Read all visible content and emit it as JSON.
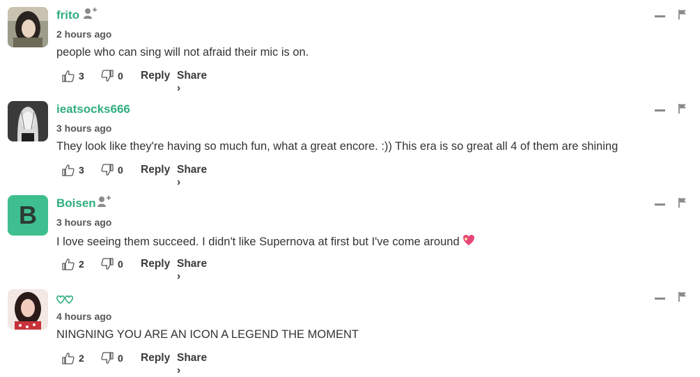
{
  "comments": [
    {
      "username": "frito",
      "timestamp": "2 hours ago",
      "text": "people who can sing will not afraid their mic is on.",
      "likes": "3",
      "dislikes": "0",
      "reply_label": "Reply",
      "share_label": "Share ›",
      "avatar": "photo",
      "has_follow": true
    },
    {
      "username": "ieatsocks666",
      "timestamp": "3 hours ago",
      "text": "They look like they're having so much fun, what a great encore. :)) This era is so great all 4 of them are shining",
      "likes": "3",
      "dislikes": "0",
      "reply_label": "Reply",
      "share_label": "Share ›",
      "avatar": "drawing",
      "has_follow": false
    },
    {
      "username": "Boisen",
      "timestamp": "3 hours ago",
      "text": "I love seeing them succeed. I didn't like Supernova at first but I've come around",
      "likes": "2",
      "dislikes": "0",
      "reply_label": "Reply",
      "share_label": "Share ›",
      "avatar": "letter",
      "avatar_letter": "B",
      "avatar_color": "#3fbf8f",
      "has_follow": true,
      "emoji": "sparkling-heart-icon"
    },
    {
      "username": "",
      "timestamp": "4 hours ago",
      "text": "NINGNING YOU ARE AN ICON A LEGEND THE MOMENT",
      "likes": "2",
      "dislikes": "0",
      "reply_label": "Reply",
      "share_label": "Share ›",
      "avatar": "photo",
      "username_icon": "double-heart-icon",
      "has_follow": false
    }
  ],
  "colors": {
    "accent": "#2fae7e",
    "icon_gray": "#8a8a8a"
  }
}
